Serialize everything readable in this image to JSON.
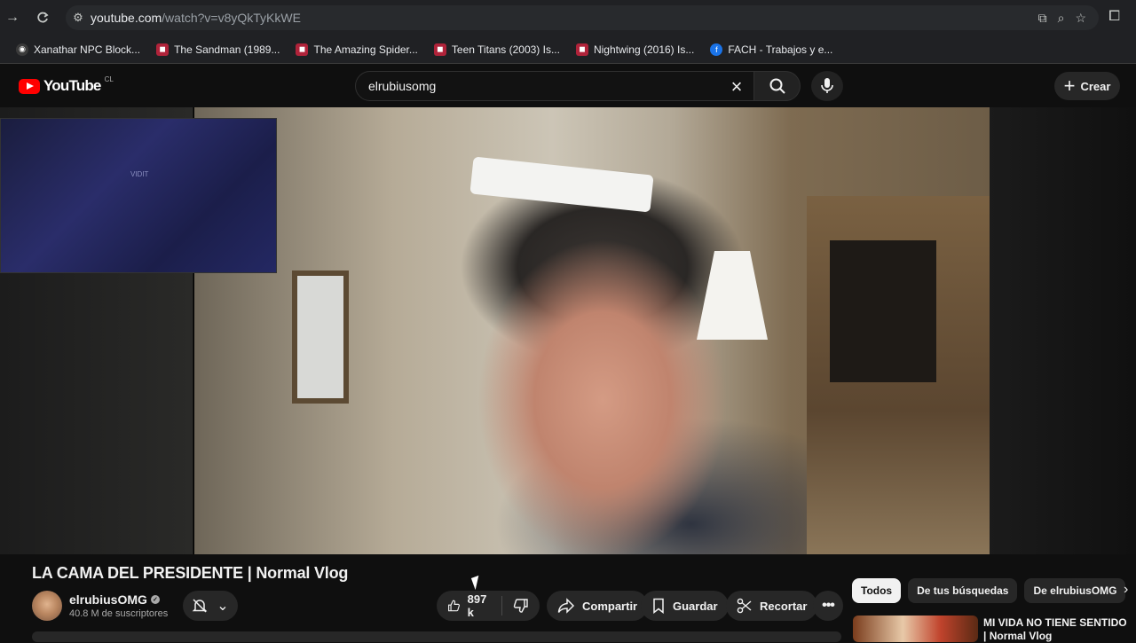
{
  "browser": {
    "url_host": "youtube.com",
    "url_path": "/watch?v=v8yQkTyKkWE",
    "bookmarks": [
      {
        "label": "Xanathar NPC Block...",
        "color": "#3a3a3a"
      },
      {
        "label": "The Sandman (1989...",
        "color": "#b0233a"
      },
      {
        "label": "The Amazing Spider...",
        "color": "#b0233a"
      },
      {
        "label": "Teen Titans (2003) Is...",
        "color": "#b0233a"
      },
      {
        "label": "Nightwing (2016) Is...",
        "color": "#b0233a"
      },
      {
        "label": "FACH - Trabajos y e...",
        "color": "#1a73e8"
      }
    ]
  },
  "header": {
    "logo_text": "YouTube",
    "country": "CL",
    "search_value": "elrubiusomg",
    "create_label": "Crear"
  },
  "pip": {
    "text": "VIDIT"
  },
  "video": {
    "title": "LA CAMA DEL PRESIDENTE | Normal Vlog",
    "channel_name": "elrubiusOMG",
    "subscribers": "40.8 M de suscriptores",
    "likes": "897 k",
    "share_label": "Compartir",
    "save_label": "Guardar",
    "clip_label": "Recortar"
  },
  "sidebar": {
    "chips": [
      {
        "label": "Todos",
        "active": true
      },
      {
        "label": "De tus búsquedas",
        "active": false
      },
      {
        "label": "De elrubiusOMG",
        "active": false
      }
    ],
    "recommendation_title": "MI VIDA NO TIENE SENTIDO | Normal Vlog"
  },
  "colors": {
    "accent": "#ff0000",
    "background": "#0f0f0f",
    "pill": "#272727"
  }
}
